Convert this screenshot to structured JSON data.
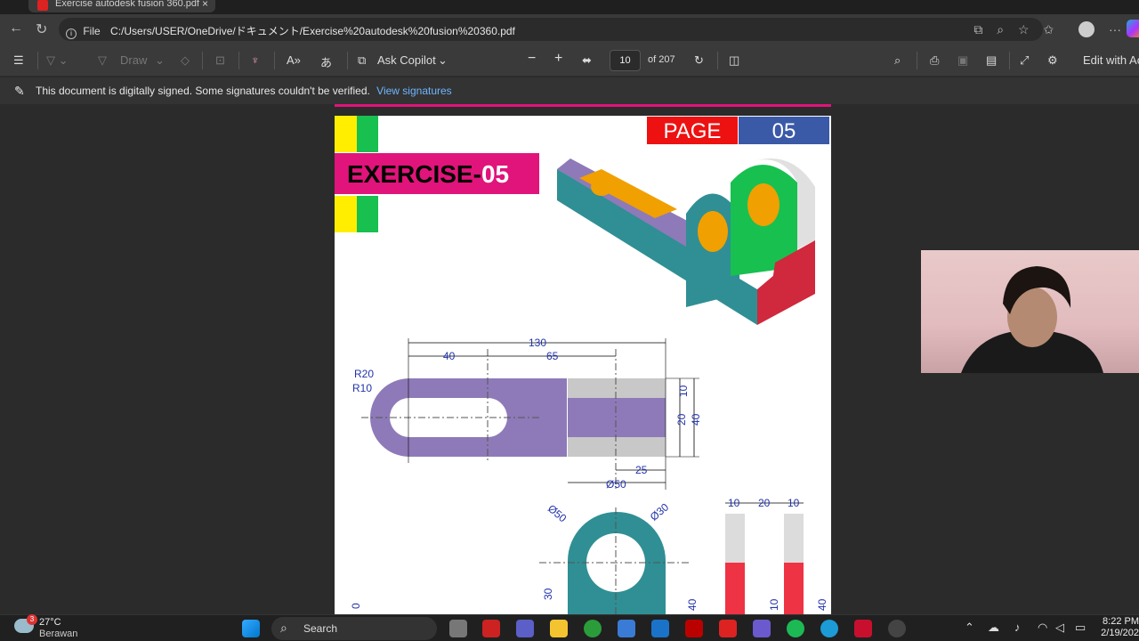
{
  "browser": {
    "tab_title": "Exercise autodesk fusion 360.pdf",
    "scheme_label": "File",
    "url": "C:/Users/USER/OneDrive/ドキュメント/Exercise%20autodesk%20fusion%20360.pdf",
    "icons": [
      "back-icon",
      "refresh-icon",
      "info-icon",
      "copilot-icon",
      "zoom-icon",
      "favorite-icon",
      "collections-icon",
      "profile-icon",
      "more-icon"
    ]
  },
  "pdf_toolbar": {
    "draw_label": "Draw",
    "ask_copilot_label": "Ask Copilot",
    "current_page": "10",
    "page_total": "of 207",
    "edit_label": "Edit with Ac"
  },
  "signature_bar": {
    "message": "This document is digitally signed. Some signatures couldn't be verified.",
    "link": "View signatures"
  },
  "pdf_page": {
    "page_word": "PAGE",
    "page_number": "05",
    "exercise_prefix": "EXERCISE-",
    "exercise_number": "05",
    "dimensions": {
      "d130": "130",
      "d40": "40",
      "d65": "65",
      "r20": "R20",
      "r10": "R10",
      "v10": "10",
      "v20": "20",
      "v40": "40",
      "d25": "25",
      "dia50": "Ø50",
      "dia50b": "Ø50",
      "dia30": "Ø30",
      "s10a": "10",
      "s20": "20",
      "s10b": "10",
      "h30": "30",
      "h40": "40",
      "h10": "10",
      "h40b": "40",
      "left0": "0"
    },
    "colors": {
      "pink": "#e0147a",
      "yellow": "#ffee00",
      "green": "#18c050",
      "red": "#ee1111",
      "blue": "#3a5aa8",
      "purple": "#8e7ab8",
      "teal": "#2f8f94",
      "orange": "#f0a000",
      "darkred": "#d0283c"
    }
  },
  "taskbar": {
    "temperature": "27°C",
    "condition": "Berawan",
    "badge": "3",
    "search_label": "Search",
    "time": "8:22 PM",
    "date": "2/19/202"
  }
}
